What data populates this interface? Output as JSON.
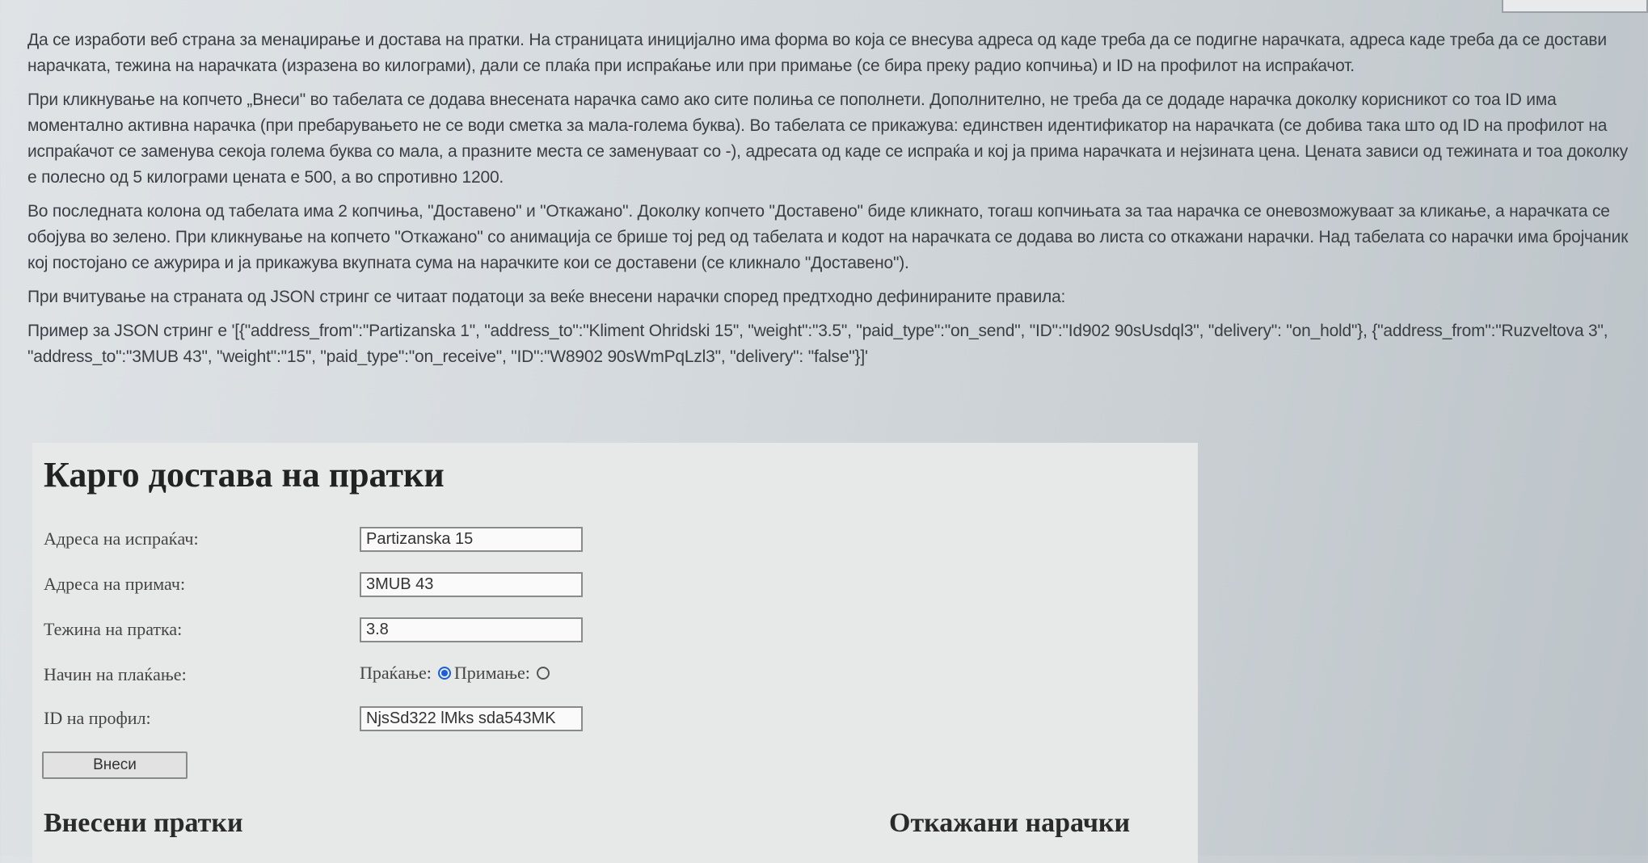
{
  "description": {
    "p1": "Да се изработи веб страна за менаџирање и достава на пратки. На страницата иницијално има форма во која се внесува адреса од каде треба да се подигне нарачката, адреса каде треба да се достави нарачката, тежина на нарачката (изразена во килограми), дали се плаќа при испраќање или при примање (се бира преку радио копчиња) и ID на профилот на испраќачот.",
    "p2": "При кликнување на копчето „Внеси\" во табелата се додава внесената нарачка само ако сите полиња се пополнети. Дополнително, не треба да се додаде нарачка доколку корисникот со тоа ID има моментално активна нарачка (при пребарувањето не се води сметка за мала-голема буква). Во табелата се прикажува: единствен идентификатор на нарачката (се добива така што од ID на профилот на испраќачот се заменува секоја голема буква со мала, а празните места се заменуваат со -), адресата од каде се испраќа и кој ја прима нарачката и нејзината цена. Цената зависи од тежината и тоа доколку е полесно од 5 килограми цената е 500, а во спротивно 1200.",
    "p3": "Во последната колона од табелата има 2 копчиња, \"Доставено\" и \"Откажано\". Доколку копчето \"Доставено\" биде кликнато, тогаш копчињата за таа нарачка се оневозможуваат за кликање, а нарачката се обојува во зелено. При кликнување на копчето \"Откажано\" со анимација се брише тој ред од табелата и кодот на нарачката се додава во листа со откажани нарачки. Над табелата со нарачки има бројчаник кој постојано се ажурира и ја прикажува вкупната сума на нарачките кои се доставени (се кликнало \"Доставено\").",
    "p4": "При вчитување на страната од JSON стринг се читаат податоци за веќе внесени нарачки според предтходно дефинираните правила:",
    "p5": "Пример за JSON стринг е '[{\"address_from\":\"Partizanska 1\", \"address_to\":\"Kliment Ohridski 15\", \"weight\":\"3.5\", \"paid_type\":\"on_send\", \"ID\":\"Id902 90sUsdql3\", \"delivery\": \"on_hold\"}, {\"address_from\":\"Ruzveltova 3\", \"address_to\":\"3MUB 43\", \"weight\":\"15\", \"paid_type\":\"on_receive\", \"ID\":\"W8902 90sWmPqLzl3\", \"delivery\": \"false\"}]'"
  },
  "panel": {
    "title": "Карго достава на пратки",
    "form": {
      "sender_label": "Адреса на испраќач:",
      "sender_value": "Partizanska 15",
      "receiver_label": "Адреса на примач:",
      "receiver_value": "3MUB 43",
      "weight_label": "Тежина на пратка:",
      "weight_value": "3.8",
      "payment_label": "Начин на плаќање:",
      "payment_send_label": "Праќање:",
      "payment_receive_label": "Примање:",
      "payment_selected": "Праќање",
      "profile_label": "ID на профил:",
      "profile_value": "NjsSd322 lMks sda543MK",
      "submit_label": "Внеси"
    },
    "entered_title": "Внесени пратки",
    "cancelled_title": "Откажани нарачки"
  },
  "colors": {
    "radio_accent": "#1a5fd6",
    "panel_bg": "#e7e8e8"
  }
}
